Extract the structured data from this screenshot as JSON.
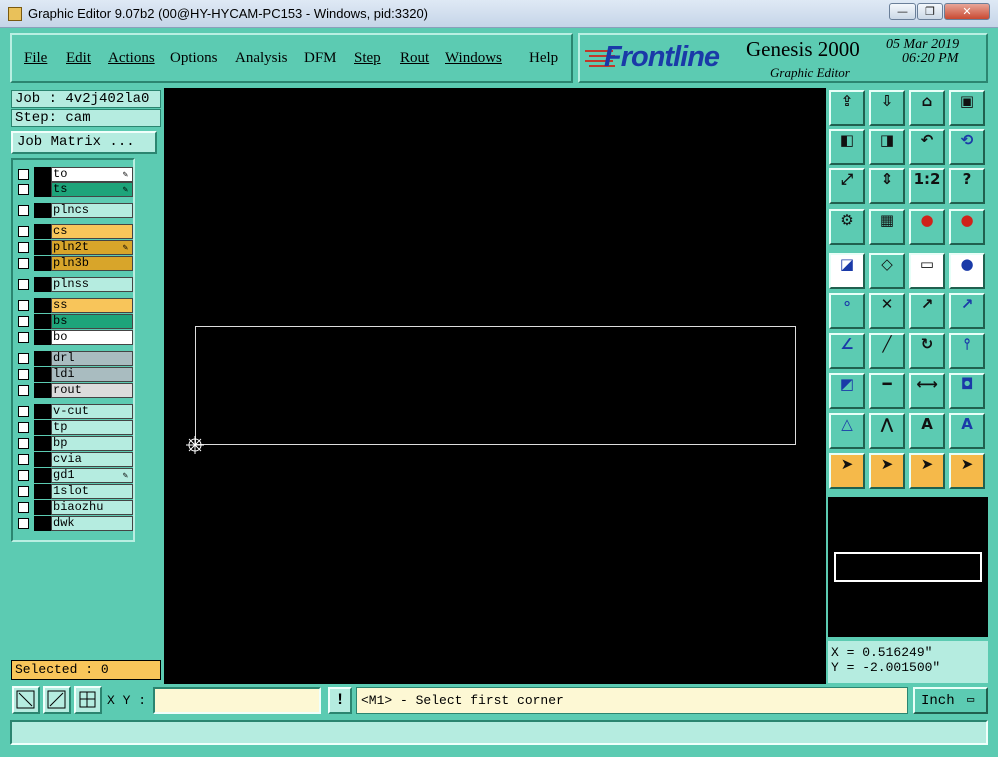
{
  "window": {
    "title": "Graphic Editor 9.07b2 (00@HY-HYCAM-PC153 - Windows, pid:3320)",
    "minimize": "—",
    "restore": "❐",
    "close": "✕"
  },
  "menu": [
    {
      "label": "File"
    },
    {
      "label": "Edit"
    },
    {
      "label": "Actions"
    },
    {
      "label": "Options"
    },
    {
      "label": "Analysis"
    },
    {
      "label": "DFM"
    },
    {
      "label": "Step"
    },
    {
      "label": "Rout"
    },
    {
      "label": "Windows"
    },
    {
      "label": "Help"
    }
  ],
  "brand": {
    "logo": "Frontline",
    "product": "Genesis 2000",
    "subtitle": "Graphic Editor",
    "date": "05 Mar 2019",
    "time": "06:20 PM"
  },
  "job": {
    "job_text": "Job : 4v2j402la0",
    "step_text": "Step: cam",
    "matrix_button": "Job Matrix ..."
  },
  "layers": [
    {
      "name": "to",
      "color": "#ffffff",
      "mark": "✎"
    },
    {
      "name": "ts",
      "color": "#1ea47a",
      "mark": "✎"
    },
    {
      "name": "plncs",
      "color": "#b5ece0",
      "mark": ""
    },
    {
      "name": "cs",
      "color": "#f8c55a",
      "mark": ""
    },
    {
      "name": "pln2t",
      "color": "#d8a52a",
      "mark": "✎"
    },
    {
      "name": "pln3b",
      "color": "#d8a52a",
      "mark": ""
    },
    {
      "name": "plnss",
      "color": "#b5ece0",
      "mark": ""
    },
    {
      "name": "ss",
      "color": "#f8c55a",
      "mark": ""
    },
    {
      "name": "bs",
      "color": "#1ea47a",
      "mark": ""
    },
    {
      "name": "bo",
      "color": "#ffffff",
      "mark": ""
    },
    {
      "name": "drl",
      "color": "#a9bcc0",
      "mark": ""
    },
    {
      "name": "ldi",
      "color": "#a9bcc0",
      "mark": ""
    },
    {
      "name": "rout",
      "color": "#dcdcdc",
      "mark": ""
    },
    {
      "name": "v-cut",
      "color": "#b5ece0",
      "mark": ""
    },
    {
      "name": "tp",
      "color": "#b5ece0",
      "mark": ""
    },
    {
      "name": "bp",
      "color": "#b5ece0",
      "mark": ""
    },
    {
      "name": "cvia",
      "color": "#b5ece0",
      "mark": ""
    },
    {
      "name": "gd1",
      "color": "#b5ece0",
      "mark": "✎"
    },
    {
      "name": "1slot",
      "color": "#b5ece0",
      "mark": ""
    },
    {
      "name": "biaozhu",
      "color": "#b5ece0",
      "mark": ""
    },
    {
      "name": "dwk",
      "color": "#b5ece0",
      "mark": ""
    }
  ],
  "selected": "Selected : 0",
  "coords": {
    "x": "X = 0.516249\"",
    "y": "Y = -2.001500\""
  },
  "bottom": {
    "xy_label": "X Y :",
    "xy_value": "",
    "bang": "!",
    "prompt": "<M1> - Select first corner",
    "unit": "Inch"
  },
  "tools": [
    "send-to-icon",
    "receive-icon",
    "home-icon",
    "window-icon",
    "pan-left-icon",
    "pan-right-icon",
    "undo-view-icon",
    "redraw-icon",
    "zoom-fit-icon",
    "zoom-home-icon",
    "scale-1-2-icon",
    "help-icon",
    "settings-icon",
    "grid-icon",
    "panel-red-icon",
    "panel-red-2-icon",
    "feature-select-icon",
    "polygon-icon",
    "ruler-icon",
    "pad-icon",
    "connect-icon",
    "delete-icon",
    "move-icon",
    "copy-icon",
    "line-icon",
    "line-edit-icon",
    "rotate-icon",
    "mirror-icon",
    "snap-icon",
    "split-icon",
    "measure-icon",
    "shapes-icon",
    "arc-icon",
    "arc-up-icon",
    "arc-center-icon",
    "arc-cross-icon",
    "pointer-icon",
    "select-pointer-icon",
    "zoom-pointer-icon",
    "route-pointer-icon"
  ]
}
